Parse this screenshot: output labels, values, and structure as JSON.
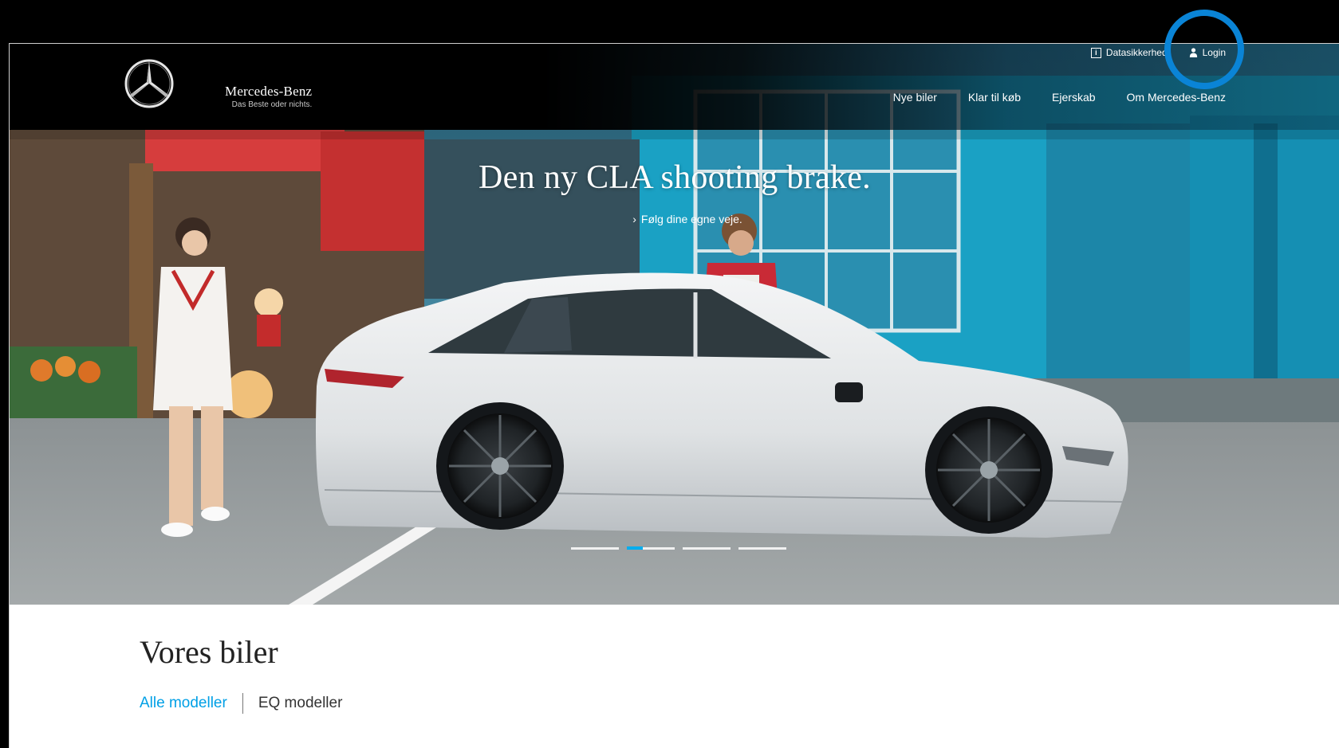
{
  "brand": {
    "name": "Mercedes-Benz",
    "tagline": "Das Beste oder nichts."
  },
  "meta_nav": {
    "privacy_label": "Datasikkerhed",
    "login_label": "Login"
  },
  "main_nav": {
    "items": [
      "Nye biler",
      "Klar til køb",
      "Ejerskab",
      "Om Mercedes-Benz"
    ]
  },
  "hero": {
    "title": "Den ny CLA shooting brake.",
    "link_label": "Følg dine egne veje.",
    "slides_total": 4,
    "active_slide": 2
  },
  "section": {
    "title": "Vores biler",
    "tabs": [
      {
        "label": "Alle modeller",
        "active": true
      },
      {
        "label": "EQ modeller",
        "active": false
      }
    ]
  },
  "colors": {
    "accent": "#00a0e6",
    "highlight_ring": "#0a84d6",
    "header_bg": "#000000"
  },
  "icons": {
    "privacy": "info-square-icon",
    "login": "person-icon",
    "logo": "mercedes-star-logo"
  }
}
